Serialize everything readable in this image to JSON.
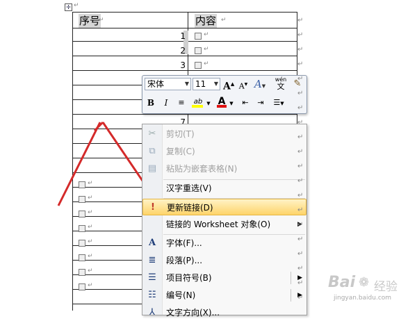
{
  "table": {
    "headers": [
      "序号",
      "内容"
    ],
    "seq_numbers": [
      "1",
      "2",
      "3",
      "7"
    ],
    "para_mark": "↵",
    "anchor_icon": "table-move-handle-icon"
  },
  "mini_toolbar": {
    "font_name": "宋体",
    "font_size": "11",
    "grow_font": "A",
    "shrink_font": "A",
    "styles": "A",
    "phonetic": "wén",
    "phonetic_char": "文",
    "bold": "B",
    "italic": "I",
    "highlight_text": "ab",
    "font_color_text": "A",
    "colors": {
      "highlight": "#ffff00",
      "font_color": "#e01010"
    }
  },
  "context_menu": {
    "items": [
      {
        "label": "剪切(T)",
        "enabled": false,
        "icon": "scissors-icon"
      },
      {
        "label": "复制(C)",
        "enabled": false,
        "icon": "copy-icon"
      },
      {
        "label": "粘贴为嵌套表格(N)",
        "enabled": false,
        "icon": "paste-icon"
      },
      {
        "label": "汉字重选(V)",
        "enabled": true,
        "icon": ""
      },
      {
        "label": "更新链接(D)",
        "enabled": true,
        "icon": "update-link-icon",
        "highlighted": true
      },
      {
        "label": "链接的 Worksheet 对象(O)",
        "enabled": true,
        "icon": "",
        "submenu": true
      },
      {
        "label": "字体(F)...",
        "enabled": true,
        "icon": "font-icon"
      },
      {
        "label": "段落(P)...",
        "enabled": true,
        "icon": "paragraph-icon"
      },
      {
        "label": "项目符号(B)",
        "enabled": true,
        "icon": "bullets-icon",
        "submenu": true
      },
      {
        "label": "编号(N)",
        "enabled": true,
        "icon": "numbering-icon",
        "submenu": true
      },
      {
        "label": "文字方向(X)...",
        "enabled": true,
        "icon": "text-direction-icon"
      }
    ]
  },
  "annotation": {
    "arrow_color": "#d42a2a"
  },
  "watermark": {
    "brand_left": "Bai",
    "brand_right": "经验",
    "url": "jingyan.baidu.com"
  }
}
